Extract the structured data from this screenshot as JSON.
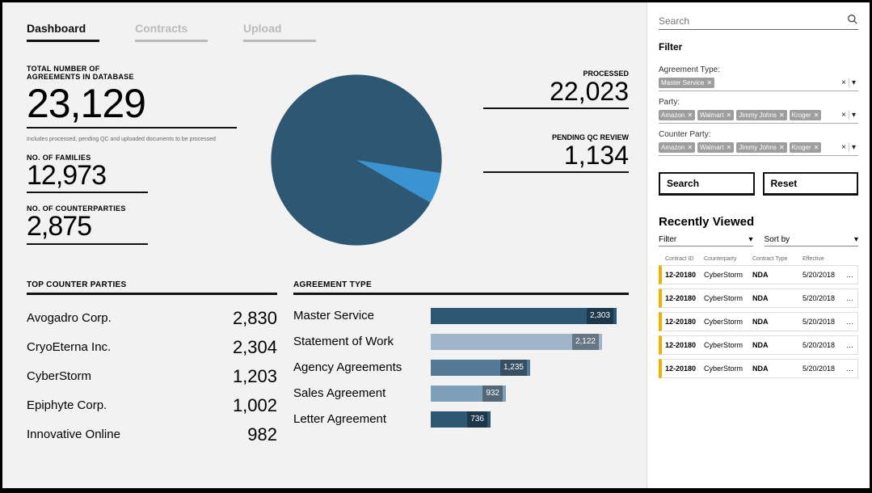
{
  "tabs": [
    "Dashboard",
    "Contracts",
    "Upload"
  ],
  "active_tab": 0,
  "stats": {
    "total_label": "TOTAL NUMBER OF\nAGREEMENTS  IN DATABASE",
    "total_value": "23,129",
    "total_note": "Includes processed, pending QC and uploaded documents to be processed",
    "families_label": "NO. OF FAMILIES",
    "families_value": "12,973",
    "cp_label": "NO. OF COUNTERPARTIES",
    "cp_value": "2,875"
  },
  "right_stats": {
    "processed_label": "PROCESSED",
    "processed_value": "22,023",
    "pending_label": "PENDING QC REVIEW",
    "pending_value": "1,134"
  },
  "chart_data": {
    "type": "pie",
    "title": "",
    "series": [
      {
        "name": "Processed",
        "value": 22023,
        "color": "#2e5774"
      },
      {
        "name": "Pending QC Review",
        "value": 1134,
        "color": "#3b94d1"
      }
    ]
  },
  "top_cp": {
    "title": "TOP COUNTER PARTIES",
    "rows": [
      {
        "name": "Avogadro Corp.",
        "value": "2,830"
      },
      {
        "name": "CryoEterna Inc.",
        "value": "2,304"
      },
      {
        "name": "CyberStorm",
        "value": "1,203"
      },
      {
        "name": "Epiphyte Corp.",
        "value": "1,002"
      },
      {
        "name": "Innovative  Online",
        "value": "982"
      }
    ]
  },
  "agreement_type": {
    "title": "AGREEMENT TYPE",
    "max": 2303,
    "rows": [
      {
        "name": "Master Service",
        "value": 2303,
        "color": "#2e5774"
      },
      {
        "name": "Statement of Work",
        "value": 2122,
        "color": "#9fb6ca"
      },
      {
        "name": "Agency Agreements",
        "value": 1235,
        "color": "#557a97"
      },
      {
        "name": "Sales Agreement",
        "value": 932,
        "color": "#7fa0ba"
      },
      {
        "name": "Letter Agreement",
        "value": 736,
        "color": "#2e5774"
      }
    ]
  },
  "sidebar": {
    "search_placeholder": "Search",
    "filter_title": "Filter",
    "agreement_type_label": "Agreement Type:",
    "agreement_type_chips": [
      "Master Service"
    ],
    "party_label": "Party:",
    "party_chips": [
      "Amazon",
      "Walmart",
      "Jimmy Johns",
      "Kroger"
    ],
    "counter_party_label": "Counter Party:",
    "counter_party_chips": [
      "Amazon",
      "Walmart",
      "Jimmy Johns",
      "Kroger"
    ],
    "search_btn": "Search",
    "reset_btn": "Reset",
    "rv_title": "Recently Viewed",
    "rv_filter": "Filter",
    "rv_sort": "Sort by",
    "rv_headers": [
      "Contract ID",
      "Counterparty",
      "Contract Type",
      "Effective"
    ],
    "rv_rows": [
      {
        "id": "12-20180",
        "cp": "CyberStorm",
        "type": "NDA",
        "eff": "5/20/2018"
      },
      {
        "id": "12-20180",
        "cp": "CyberStorm",
        "type": "NDA",
        "eff": "5/20/2018"
      },
      {
        "id": "12-20180",
        "cp": "CyberStorm",
        "type": "NDA",
        "eff": "5/20/2018"
      },
      {
        "id": "12-20180",
        "cp": "CyberStorm",
        "type": "NDA",
        "eff": "5/20/2018"
      },
      {
        "id": "12-20180",
        "cp": "CyberStorm",
        "type": "NDA",
        "eff": "5/20/2018"
      }
    ]
  }
}
